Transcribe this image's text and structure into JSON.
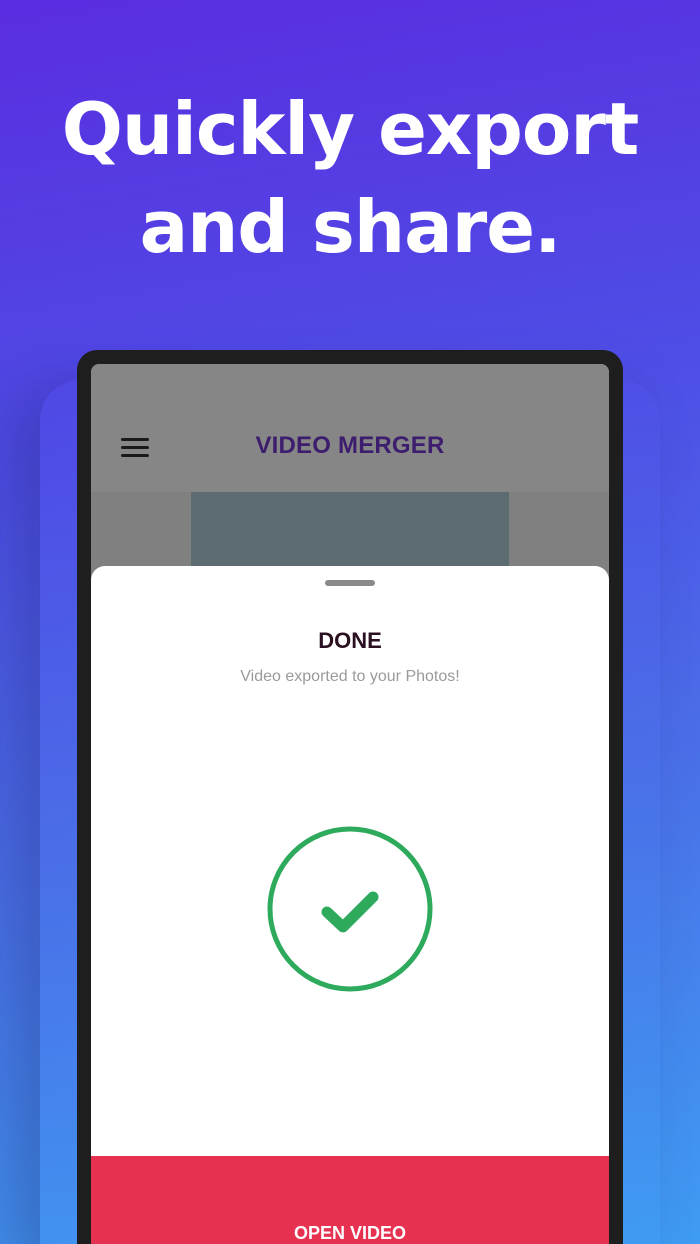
{
  "headline": {
    "line1": "Quickly export",
    "line2": "and share."
  },
  "app": {
    "title": "VIDEO MERGER",
    "menu_icon": "hamburger-menu-icon"
  },
  "sheet": {
    "title": "DONE",
    "subtitle": "Video exported to your Photos!",
    "status_icon": "checkmark-circle-icon",
    "button_label": "OPEN VIDEO"
  },
  "colors": {
    "accent_red": "#e63150",
    "success_green": "#2eaa5c",
    "title_purple": "#3d1e6e"
  }
}
